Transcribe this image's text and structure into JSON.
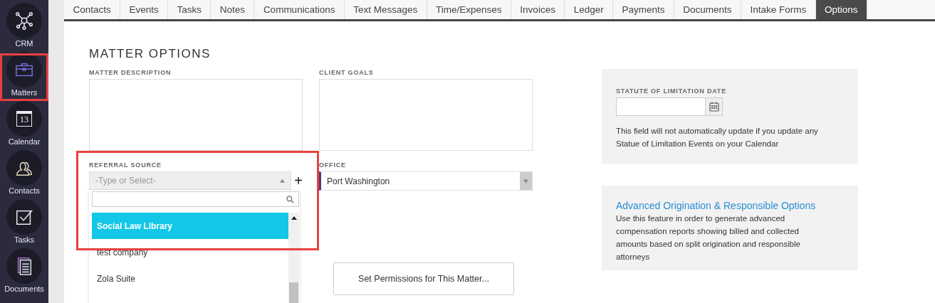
{
  "sidebar": {
    "items": [
      {
        "label": "CRM",
        "kind": "crm",
        "highlighted": false
      },
      {
        "label": "Matters",
        "kind": "matters",
        "highlighted": true
      },
      {
        "label": "Calendar",
        "kind": "calendar",
        "icon_text": "13",
        "highlighted": false
      },
      {
        "label": "Contacts",
        "kind": "contacts",
        "highlighted": false
      },
      {
        "label": "Tasks",
        "kind": "tasks",
        "highlighted": false
      },
      {
        "label": "Documents",
        "kind": "documents",
        "highlighted": false
      }
    ]
  },
  "tabs": [
    {
      "label": "Contacts",
      "selected": false
    },
    {
      "label": "Events",
      "selected": false
    },
    {
      "label": "Tasks",
      "selected": false
    },
    {
      "label": "Notes",
      "selected": false
    },
    {
      "label": "Communications",
      "selected": false
    },
    {
      "label": "Text Messages",
      "selected": false
    },
    {
      "label": "Time/Expenses",
      "selected": false
    },
    {
      "label": "Invoices",
      "selected": false
    },
    {
      "label": "Ledger",
      "selected": false
    },
    {
      "label": "Payments",
      "selected": false
    },
    {
      "label": "Documents",
      "selected": false
    },
    {
      "label": "Intake Forms",
      "selected": false
    },
    {
      "label": "Options",
      "selected": true
    }
  ],
  "heading": "MATTER OPTIONS",
  "matter_description": {
    "label": "MATTER DESCRIPTION"
  },
  "client_goals": {
    "label": "CLIENT GOALS"
  },
  "referral_source": {
    "label": "REFERRAL SOURCE",
    "placeholder": "-Type or Select-",
    "plus": "+",
    "highlighted": true,
    "dropdown": {
      "options": [
        {
          "label": "Social Law Library",
          "selected": true
        },
        {
          "label": "test company",
          "selected": false
        },
        {
          "label": "Zola Suite",
          "selected": false
        }
      ]
    }
  },
  "office": {
    "label": "OFFICE",
    "value": "Port Washington"
  },
  "permissions_button": "Set Permissions for This Matter...",
  "statute_panel": {
    "label": "STATUTE OF LIMITATION DATE",
    "note": "This field will not automatically update if you update any Statue of Limitation Events on your Calendar"
  },
  "origination_panel": {
    "link": "Advanced Origination & Responsible Options",
    "text": "Use this feature in order to generate advanced compensation reports showing billed and collected amounts based on split origination and responsible attorneys"
  }
}
